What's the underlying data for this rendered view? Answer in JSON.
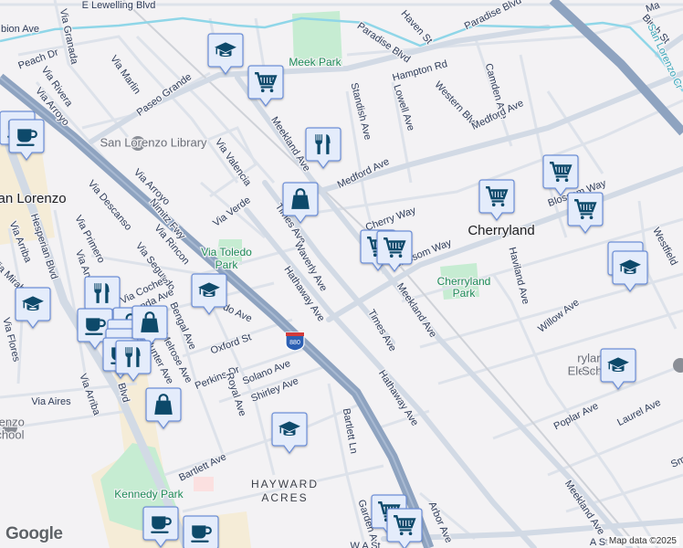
{
  "map": {
    "street_labels": [
      "E Lewelling Blvd",
      "bion Ave",
      "Via Granada",
      "Peach Dr",
      "Via Rivera",
      "Via Arroyo",
      "Via Marlin",
      "Paseo Grande",
      "Hampton Rd",
      "Haven St",
      "Paradise Blvd",
      "Paradise Blvd",
      "Standish Ave",
      "Lowell Ave",
      "Western Blvd",
      "Camden Ave",
      "Medford Ave",
      "Medford Ave",
      "Meekland Ave",
      "Birch St",
      "Via Valencia",
      "Via Arroyo",
      "Via Verde",
      "Times Ave",
      "Cherry Way",
      "Blossom Way",
      "Blossom Way",
      "Haviland Ave",
      "Westfield",
      "Nimitz Fwy",
      "Via Descanso",
      "Hesperian Blvd",
      "Via Primero",
      "Via Arriba",
      "Via Rincon",
      "Via Segundo",
      "Waverly Ave",
      "Hathaway Ave",
      "Via Mirabel",
      "Via Coches",
      "Via And",
      "nda Ave",
      "Bengal Ave",
      "Melrose Ave",
      "Hunter Ave",
      "do Ave",
      "Oxford St",
      "Perkins Dr",
      "Solano Ave",
      "Shirley Ave",
      "Royal Ave",
      "Times Ave",
      "Meekland Ave",
      "Willow Ave",
      "Poplar Ave",
      "Laurel Ave",
      "Hathaway Ave",
      "Via Flores",
      "Via Arriba",
      "Blvd",
      "Via Aires",
      "Bartlett Ln",
      "Bartlett Ave",
      "Meekland Ave",
      "Arbor Ave",
      "Garden Ave",
      "W A St",
      "A St",
      "Sm",
      "Ma"
    ],
    "park_labels": [
      "Meek Park",
      "Via Toledo",
      "Park",
      "Cherryland",
      "Park",
      "Kennedy Park"
    ],
    "poi_labels": [
      "San Lorenzo Library",
      "San Lorenzo",
      "Adult School",
      "ryland",
      "Eleme",
      "School"
    ],
    "town_labels": [
      "Cherryland",
      "San Lorenzo"
    ],
    "area_labels": [
      "HAYWARD",
      "ACRES"
    ],
    "creek_label": "San Lorenzo Cr",
    "highway_shield": "880",
    "markers": [
      "school",
      "cart",
      "restaurant",
      "shopping-bag",
      "cart",
      "cart",
      "cart",
      "cart",
      "cart",
      "school",
      "school",
      "coffee",
      "coffee",
      "school",
      "school",
      "restaurant",
      "shopping-bag",
      "coffee",
      "coffee",
      "coffee",
      "coffee",
      "shopping-bag",
      "restaurant",
      "shopping-bag",
      "school",
      "school",
      "coffee",
      "coffee",
      "cart",
      "cart"
    ],
    "attribution": "Map data ©2025",
    "logo": "Google"
  },
  "colors": {
    "background": "#f3f2f4",
    "road": "#d5dce6",
    "freeway": "#8ea3c0",
    "park": "#c6ecd2",
    "creek": "#8fd6e8",
    "marker_fill": "#e4ecfb",
    "marker_border": "#6c8ed6",
    "marker_icon": "#0b486b"
  }
}
